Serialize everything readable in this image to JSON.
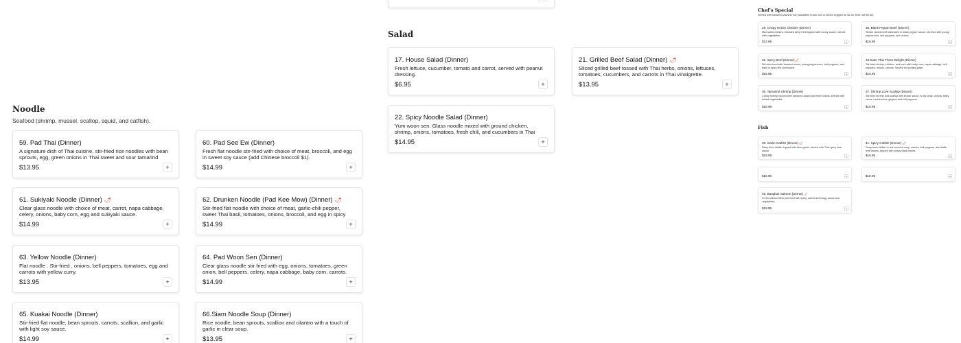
{
  "noodle_section": {
    "title": "Noodle",
    "subtitle": "Seafood (shrimp, mussel, scallop, squid, and catfish).",
    "items": [
      {
        "title": "59. Pad Thai (Dinner)",
        "desc": "A signature dish of Thai cuisine, stir-fried rice noodles with bean sprouts, egg, green onions in Thai sweet and sour tamarind sauce.",
        "price": "$13.95",
        "spicy": false
      },
      {
        "title": "60. Pad See Ew (Dinner)",
        "desc": "Fresh flat noodle stir-fried with choice of meat, broccoli, and egg in sweet soy sauce (add Chinese broccoli $1).",
        "price": "$14.99",
        "spicy": false
      },
      {
        "title": "61. Sukiyaki Noodle (Dinner)",
        "desc": "Clear glass noodle with choice of meat, carrot, napa cabbage, celery, onions, baby corn, egg and sukiyaki sauce.",
        "price": "$14.99",
        "spicy": true
      },
      {
        "title": "62. Drunken Noodle (Pad Kee Mow) (Dinner)",
        "desc": "Stir-fried flat noodle with choice of meat, garlic-chili pepper, sweet Thai basil, tomatoes, onions, broccoli, and egg in spicy sauce.",
        "price": "$14.99",
        "spicy": true
      },
      {
        "title": "63. Yellow Noodle (Dinner)",
        "desc": "Flat noodle . Stir-fried , onions, bell peppers, tomatoes, egg and carrots with yellow curry.",
        "price": "$13.95",
        "spicy": false
      },
      {
        "title": "64. Pad Woon Sen (Dinner)",
        "desc": "Clear glass noodle stir fried with egg, onions, tomatoes, green onion, bell peppers, celery, napa cabbage, baby corn, carrots.",
        "price": "$14.99",
        "spicy": false
      },
      {
        "title": "65. Kuakai Noodle (Dinner)",
        "desc": "Stir-fried flat noodle, bean sprouts, carrots, scallion, and garlic with light soy sauce.",
        "price": "$14.99",
        "spicy": false
      },
      {
        "title": "66.Siam Noodle Soup (Dinner)",
        "desc": "Rice noodle, bean sprouts, scallion and cilantro with a touch of garlic in clear soup.",
        "price": "$13.95",
        "spicy": false
      }
    ]
  },
  "salad_section": {
    "title": "Salad",
    "items": [
      {
        "title": "17. House Salad (Dinner)",
        "desc": "Fresh lettuce, cucumber, tomato and carrot, served with peanut dressing.",
        "price": "$6.95",
        "spicy": false
      },
      {
        "title": "21. Grilled Beef Salad (Dinner)",
        "desc": "Sliced grilled beef tossed with Thai herbs, onions, lettuces, tomatoes, cucumbers, and carrots in Thai vinaigrette.",
        "price": "$13.95",
        "spicy": true
      },
      {
        "title": "22. Spicy Noodle Salad (Dinner)",
        "desc": "Yum woon sen. Glass noodle mixed with ground chicken, shrimp, onions, tomatoes, fresh chili, and cucumbers in Thai lime dressing.",
        "price": "$14.95",
        "spicy": false
      }
    ]
  },
  "chef_section": {
    "title": "Chef's Special",
    "subtitle": "Served with steamed jasmine rice (substitute brown rice or steam veggies for $1.00, fried rice $2.50).",
    "items": [
      {
        "title": "29. Crispy Honey Chicken (Dinner)",
        "desc": "Marinated chicken, breaded deep fried topped with honey sauce, served with vegetables.",
        "price": "$13.95",
        "spicy": false
      },
      {
        "title": "30. Black Pepper Beef (Dinner)",
        "desc": "Tender sliced beef marinated in black pepper sauce, stir-fried with young peppercorn, bell peppers, and onions.",
        "price": "$15.95",
        "spicy": false
      },
      {
        "title": "31. Spicy Beef (Dinner)",
        "desc": "Stir-fried beef with bamboo shoot, young peppercorn, bell peppers, and basil in spicy red chili sauce.",
        "price": "$15.95",
        "spicy": true
      },
      {
        "title": "34.Siam Thai Three Delight (Dinner)",
        "desc": "Stir-fried shrimp, chicken, and pork with baby corn, napa cabbage, bell peppers, onions, carrots. Served on sizzling plate.",
        "price": "$15.95",
        "spicy": false
      },
      {
        "title": "35. Tamarind Shrimp (Dinner)",
        "desc": "Crispy shrimp topped with tamarind sauce and fried onions, served with mixed vegetables.",
        "price": "$16.99",
        "spicy": false
      },
      {
        "title": "37. Shrimp Love Scallop (Dinner)",
        "desc": "Stir-fried shrimp and scallop with brown sauce, snow peas, onions, baby corns, mushrooms, gingers and bell peppers.",
        "price": "$19.99",
        "spicy": false
      }
    ]
  },
  "fish_section": {
    "title": "Fish",
    "items": [
      {
        "title": "39. Garlic Catfish (Dinner)",
        "desc": "Deep fried catfish topped with fried garlic, served with Thai spicy lime sauce.",
        "price": "$16.95",
        "spicy": true
      },
      {
        "title": "41. Spicy Catfish (Dinner)",
        "desc": "Deep fried catfish in red coconut curry, carrots, bell peppers, and kaffir lime leaves, topped with crispy basil leaves.",
        "price": "$16.95",
        "spicy": true
      },
      {
        "title": "",
        "desc": "",
        "price": "$16.95",
        "spicy": false
      },
      {
        "title": "",
        "desc": "",
        "price": "$18.95",
        "spicy": false
      },
      {
        "title": "46. Bangkok Salmon (Dinner)",
        "desc": "Fresh salmon filets pan fried with spicy, sweet and tangy sauce and vegetables.",
        "price": "$18.95",
        "spicy": true
      }
    ]
  },
  "add_label": "+",
  "spicy_icon": "🌶"
}
